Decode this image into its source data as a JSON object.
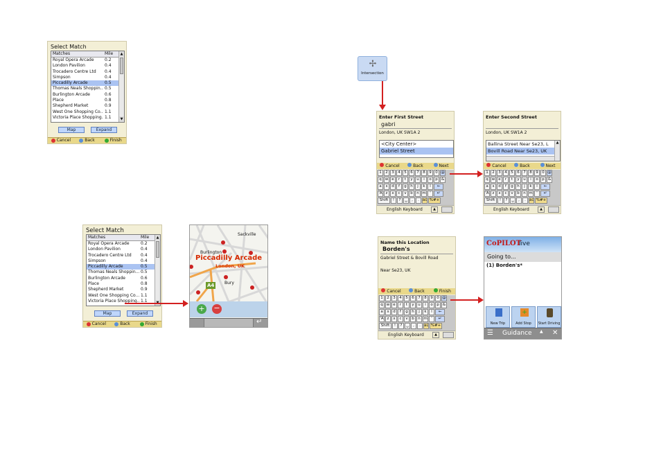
{
  "select_match": {
    "title": "Select Match",
    "col_matches": "Matches",
    "col_mile": "Mile",
    "rows": [
      {
        "name": "Royal Opera Arcade",
        "mile": "0.2"
      },
      {
        "name": "London Pavilion",
        "mile": "0.4"
      },
      {
        "name": "Trocadero Centre Ltd",
        "mile": "0.4"
      },
      {
        "name": "Simpson",
        "mile": "0.4"
      },
      {
        "name": "Piccadilly Arcade",
        "mile": "0.5"
      },
      {
        "name": "Thomas Neals Shoppin...",
        "mile": "0.5"
      },
      {
        "name": "Burlington Arcade",
        "mile": "0.6"
      },
      {
        "name": "Place",
        "mile": "0.8"
      },
      {
        "name": "Shepherd Market",
        "mile": "0.9"
      },
      {
        "name": "West One Shopping Co...",
        "mile": "1.1"
      },
      {
        "name": "Victoria Place Shopping...",
        "mile": "1.1"
      }
    ],
    "map_button": "Map",
    "expand_button": "Expand",
    "cancel": "Cancel",
    "back": "Back",
    "finish": "Finish"
  },
  "map_screen": {
    "place_title": "Piccadilly Arcade",
    "place_sub": "London, UK",
    "labels": [
      "Burlington",
      "Sackville",
      "Bury"
    ],
    "road_badge": "A4"
  },
  "intersection": {
    "label": "Intersection"
  },
  "first_street": {
    "title": "Enter First Street",
    "value": "gabri",
    "location": "London, UK SW1A 2",
    "options": [
      "<City Center>",
      "Gabriel Street"
    ],
    "cancel": "Cancel",
    "back": "Back",
    "next": "Next",
    "keyboard_label": "English Keyboard"
  },
  "second_street": {
    "title": "Enter Second Street",
    "location": "London, UK SW1A 2",
    "options": [
      "Ballina Street  Near Se23, L",
      "Bovill Road  Near Se23, UK"
    ],
    "cancel": "Cancel",
    "back": "Back",
    "next": "Next",
    "keyboard_label": "English Keyboard"
  },
  "name_location": {
    "title": "Name this Location",
    "value": "Borden's",
    "line1": "Gabriel Street & Bovill Road",
    "line2": "Near Se23, UK",
    "cancel": "Cancel",
    "back": "Back",
    "finish": "Finish",
    "keyboard_label": "English Keyboard"
  },
  "keyboard": {
    "row1": [
      "1",
      "2",
      "3",
      "4",
      "5",
      "6",
      "7",
      "8",
      "9",
      "0",
      "@"
    ],
    "row2": [
      "q",
      "w",
      "e",
      "r",
      "t",
      "y",
      "u",
      "i",
      "o",
      "p",
      "&"
    ],
    "row3": [
      "a",
      "s",
      "d",
      "f",
      "g",
      "h",
      "j",
      "k",
      "l",
      "←"
    ],
    "row4": [
      "'A",
      "z",
      "x",
      "c",
      "v",
      "b",
      "n",
      "m",
      "'",
      "↵"
    ],
    "row5": [
      "Shift",
      "!",
      "?",
      "␣",
      ",",
      ".",
      "àü",
      "%#+"
    ]
  },
  "copilot": {
    "brand": "CoPILOT",
    "brand_live": "live",
    "going_to": "Going to...",
    "dest": "(1) Borden's*",
    "new_trip": "New Trip",
    "add_stop": "Add Stop",
    "start_driving": "Start Driving",
    "guidance": "Guidance"
  },
  "colors": {
    "accent": "#d32020",
    "selection": "#aac3f2",
    "panel": "#f3efd6",
    "bar": "#e9d88a"
  }
}
